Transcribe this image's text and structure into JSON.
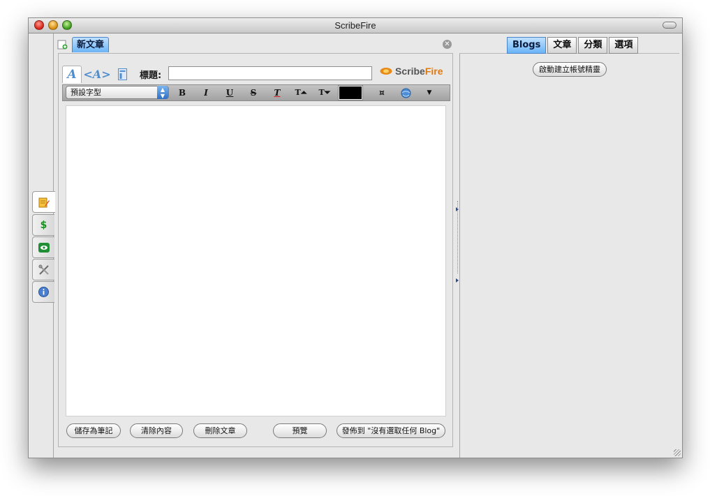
{
  "window": {
    "title": "ScribeFire"
  },
  "left_sidebar": {
    "tabs": [
      {
        "name": "editor",
        "icon": "notepad-pencil-icon"
      },
      {
        "name": "monetize",
        "icon": "dollar-icon"
      },
      {
        "name": "links",
        "icon": "eye-icon"
      },
      {
        "name": "tools",
        "icon": "tools-icon"
      },
      {
        "name": "about",
        "icon": "info-icon"
      }
    ]
  },
  "document_tab": {
    "label": "新文章"
  },
  "editor": {
    "title_label": "標題:",
    "title_value": "",
    "brand_prefix": "Scribe",
    "brand_suffix": "Fire",
    "mode_tabs": [
      "A",
      "<A>"
    ],
    "font_select": {
      "selected": "預設字型"
    },
    "toolbar_glyphs": {
      "bold": "B",
      "italic": "I",
      "underline": "U",
      "strike": "S",
      "clear": "T",
      "grow": "T⏶",
      "shrink": "T⏷",
      "more": "▼",
      "special": "¤"
    },
    "text_color": "#000000",
    "body_text": ""
  },
  "buttons": {
    "save_note": "儲存為筆記",
    "clear": "清除內容",
    "delete": "刪除文章",
    "preview": "預覽",
    "publish": "發佈到 \"沒有選取任何 Blog\""
  },
  "right_panel": {
    "tabs": [
      {
        "label": "Blogs",
        "active": true
      },
      {
        "label": "文章",
        "active": false
      },
      {
        "label": "分類",
        "active": false
      },
      {
        "label": "選項",
        "active": false
      }
    ],
    "wizard_button": "啟動建立帳號精靈"
  },
  "colors": {
    "accent_tab": "#6bb4f7",
    "brand_orange": "#e07a10",
    "brand_gray": "#555555"
  }
}
